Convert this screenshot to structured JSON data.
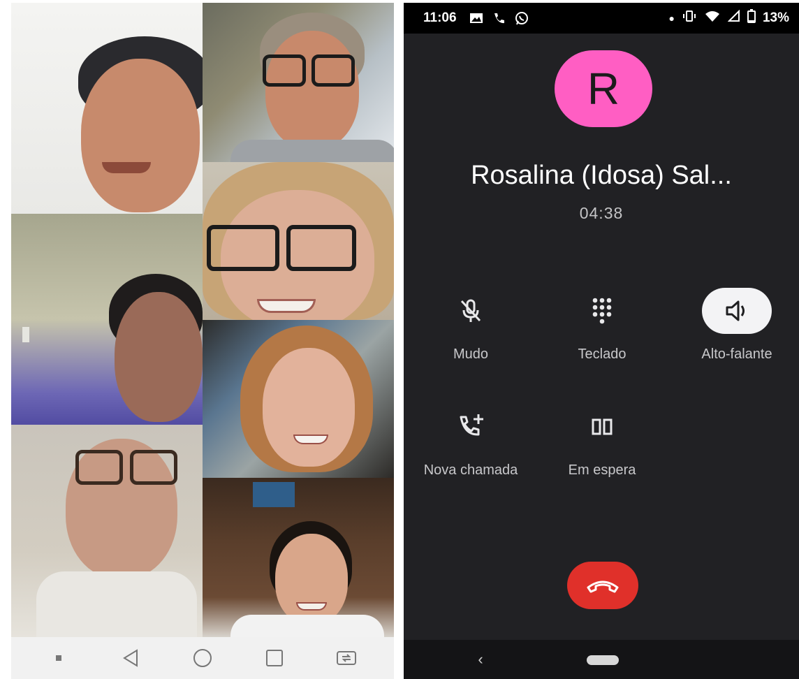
{
  "dialer": {
    "status_bar": {
      "time": "11:06",
      "battery": "13%",
      "icons_left": [
        "image-icon",
        "phone-icon",
        "whatsapp-icon"
      ],
      "icons_right": [
        "dot-icon",
        "vibrate-icon",
        "wifi-icon",
        "signal-icon",
        "battery-icon"
      ]
    },
    "avatar_letter": "R",
    "avatar_color": "#ff5ec3",
    "contact_name": "Rosalina (Idosa) Sal...",
    "call_duration": "04:38",
    "actions": [
      {
        "label": "Mudo",
        "icon": "mic-off-icon"
      },
      {
        "label": "Teclado",
        "icon": "dialpad-icon"
      },
      {
        "label": "Alto-falante",
        "icon": "speaker-icon",
        "active": true
      },
      {
        "label": "Nova chamada",
        "icon": "add-call-icon"
      },
      {
        "label": "Em espera",
        "icon": "pause-icon"
      }
    ],
    "end_call_color": "#e0302a",
    "nav": {
      "back": "‹"
    }
  },
  "video_call": {
    "participant_tiles": 7,
    "nav_icons": [
      "square-icon",
      "back-triangle-icon",
      "home-circle-icon",
      "recents-square-icon",
      "rotate-screen-icon"
    ]
  }
}
